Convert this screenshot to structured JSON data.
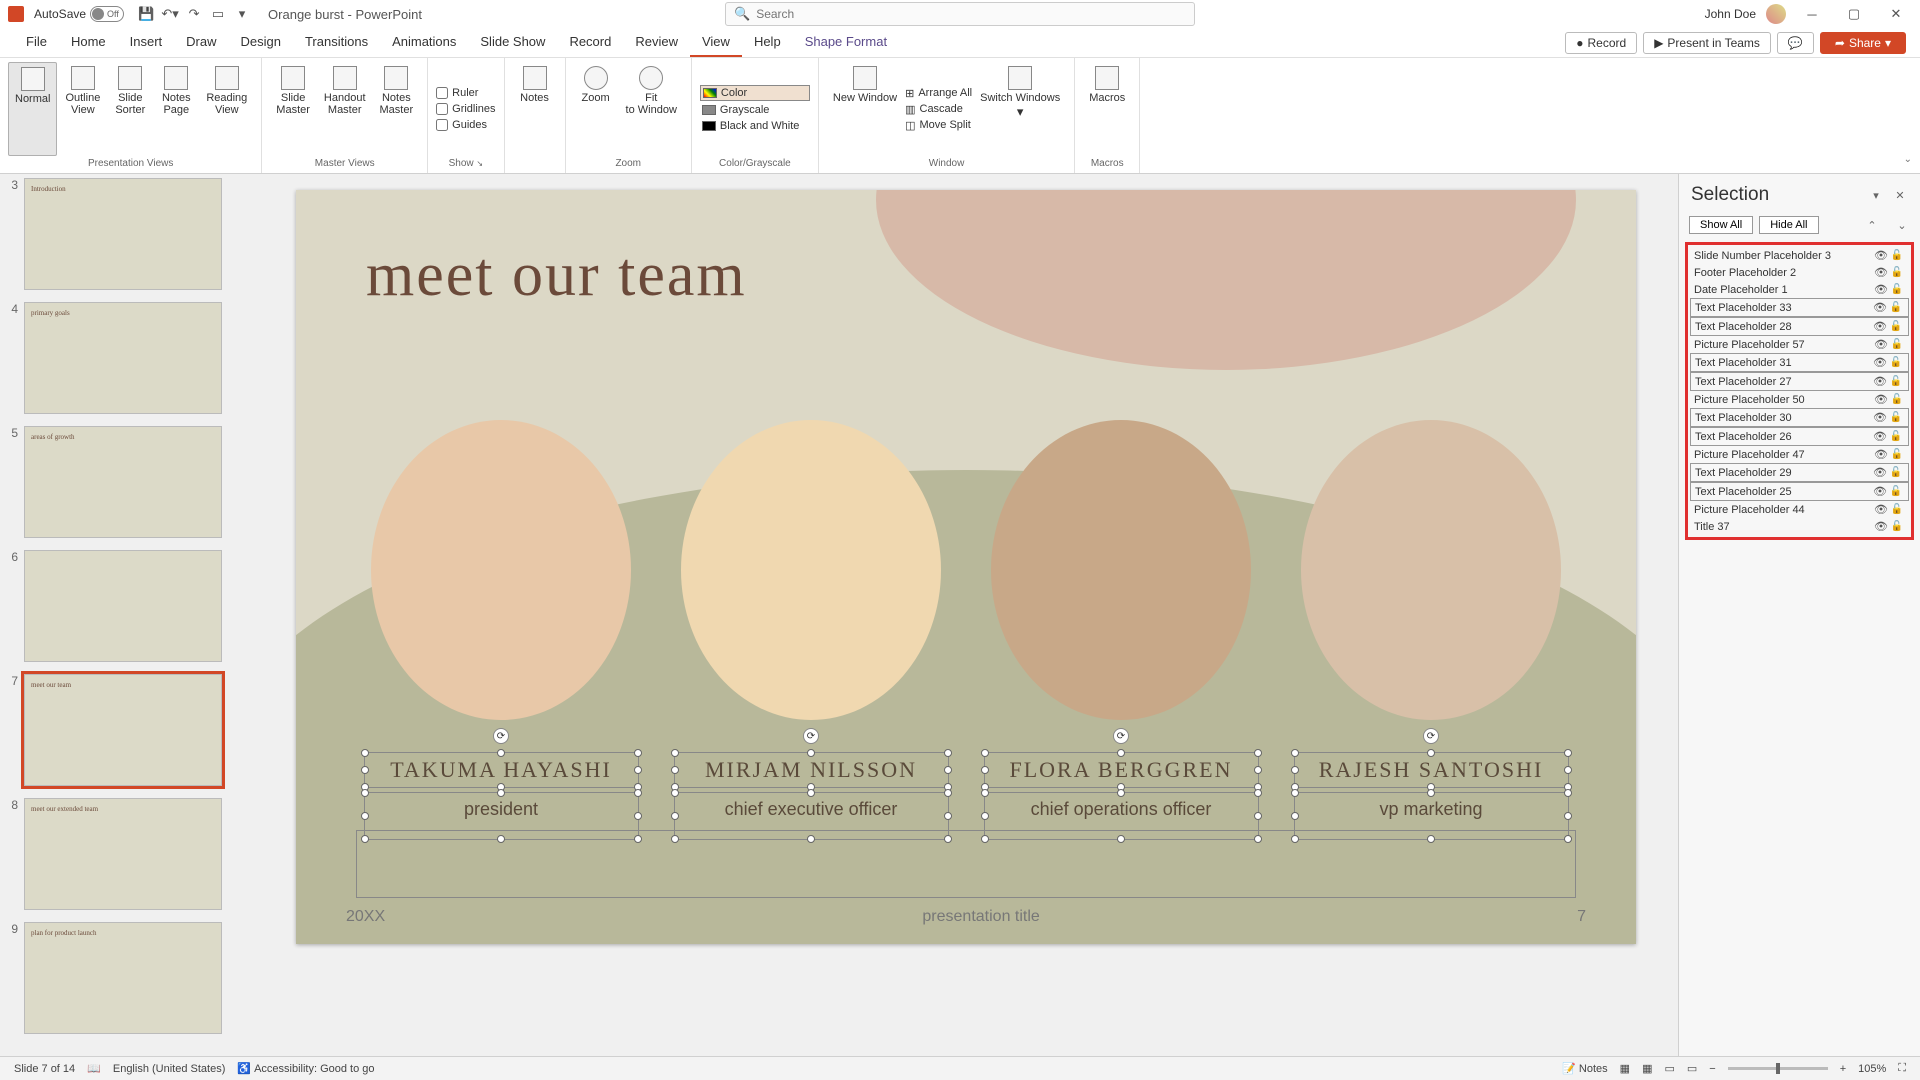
{
  "titlebar": {
    "autosave": "AutoSave",
    "autosave_state": "Off",
    "doc": "Orange burst  -  PowerPoint",
    "search_placeholder": "Search",
    "user": "John Doe"
  },
  "tabs": [
    "File",
    "Home",
    "Insert",
    "Draw",
    "Design",
    "Transitions",
    "Animations",
    "Slide Show",
    "Record",
    "Review",
    "View",
    "Help",
    "Shape Format"
  ],
  "active_tab": "View",
  "right_actions": {
    "record": "Record",
    "present": "Present in Teams",
    "share": "Share"
  },
  "ribbon": {
    "presentation_views": {
      "label": "Presentation Views",
      "buttons": [
        "Normal",
        "Outline View",
        "Slide Sorter",
        "Notes Page",
        "Reading View"
      ]
    },
    "master_views": {
      "label": "Master Views",
      "buttons": [
        "Slide Master",
        "Handout Master",
        "Notes Master"
      ]
    },
    "show": {
      "label": "Show",
      "options": [
        "Ruler",
        "Gridlines",
        "Guides"
      ]
    },
    "notes": "Notes",
    "zoom": {
      "label": "Zoom",
      "buttons": [
        "Zoom",
        "Fit to Window"
      ]
    },
    "color": {
      "label": "Color/Grayscale",
      "options": [
        "Color",
        "Grayscale",
        "Black and White"
      ]
    },
    "window": {
      "label": "Window",
      "new": "New Window",
      "arrange": "Arrange All",
      "cascade": "Cascade",
      "split": "Move Split",
      "switch": "Switch Windows"
    },
    "macros": {
      "label": "Macros",
      "btn": "Macros"
    }
  },
  "thumbnails": [
    {
      "n": 3,
      "title": "Introduction"
    },
    {
      "n": 4,
      "title": "primary goals"
    },
    {
      "n": 5,
      "title": "areas of growth"
    },
    {
      "n": 6,
      "title": ""
    },
    {
      "n": 7,
      "title": "meet our team",
      "selected": true
    },
    {
      "n": 8,
      "title": "meet our extended team"
    },
    {
      "n": 9,
      "title": "plan for product launch"
    }
  ],
  "slide": {
    "title": "meet our team",
    "members": [
      {
        "name": "TAKUMA HAYASHI",
        "role": "president"
      },
      {
        "name": "MIRJAM NILSSON",
        "role": "chief executive officer"
      },
      {
        "name": "FLORA BERGGREN",
        "role": "chief operations officer"
      },
      {
        "name": "RAJESH SANTOSHI",
        "role": "vp marketing"
      }
    ],
    "footer_year": "20XX",
    "footer_title": "presentation title",
    "footer_page": "7"
  },
  "selection_pane": {
    "title": "Selection",
    "show_all": "Show All",
    "hide_all": "Hide All",
    "items": [
      {
        "name": "Slide Number Placeholder 3",
        "boxed": false
      },
      {
        "name": "Footer Placeholder 2",
        "boxed": false
      },
      {
        "name": "Date Placeholder 1",
        "boxed": false
      },
      {
        "name": "Text Placeholder 33",
        "boxed": true
      },
      {
        "name": "Text Placeholder 28",
        "boxed": true
      },
      {
        "name": "Picture Placeholder 57",
        "boxed": false
      },
      {
        "name": "Text Placeholder 31",
        "boxed": true
      },
      {
        "name": "Text Placeholder 27",
        "boxed": true
      },
      {
        "name": "Picture Placeholder 50",
        "boxed": false
      },
      {
        "name": "Text Placeholder 30",
        "boxed": true
      },
      {
        "name": "Text Placeholder 26",
        "boxed": true
      },
      {
        "name": "Picture Placeholder 47",
        "boxed": false
      },
      {
        "name": "Text Placeholder 29",
        "boxed": true
      },
      {
        "name": "Text Placeholder 25",
        "boxed": true
      },
      {
        "name": "Picture Placeholder 44",
        "boxed": false
      },
      {
        "name": "Title 37",
        "boxed": false
      }
    ]
  },
  "status": {
    "slide": "Slide 7 of 14",
    "lang": "English (United States)",
    "access": "Accessibility: Good to go",
    "notes": "Notes",
    "zoom": "105%"
  }
}
